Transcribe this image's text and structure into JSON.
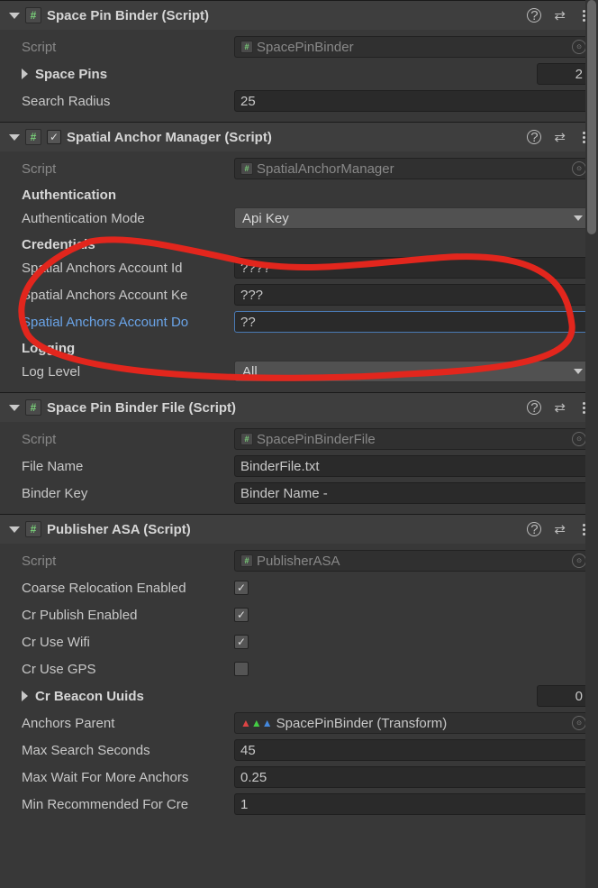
{
  "components": [
    {
      "key": "spb",
      "title": "Space Pin Binder (Script)",
      "checkbox": false,
      "script": "SpacePinBinder",
      "spacePinsCount": "2",
      "searchRadius": "25",
      "labels": {
        "script": "Script",
        "spacePins": "Space Pins",
        "searchRadius": "Search Radius"
      }
    },
    {
      "key": "sam",
      "title": "Spatial Anchor Manager (Script)",
      "checkbox": true,
      "checked": true,
      "script": "SpatialAnchorManager",
      "auth": {
        "header": "Authentication",
        "modeLabel": "Authentication Mode",
        "mode": "Api Key"
      },
      "creds": {
        "header": "Credentials",
        "idLabel": "Spatial Anchors Account Id",
        "id": "????",
        "keyLabel": "Spatial Anchors Account Ke",
        "keyv": "???",
        "domLabel": "Spatial Anchors Account Do",
        "dom": "??"
      },
      "log": {
        "header": "Logging",
        "levelLabel": "Log Level",
        "level": "All"
      },
      "labels": {
        "script": "Script"
      }
    },
    {
      "key": "spbf",
      "title": "Space Pin Binder File (Script)",
      "checkbox": false,
      "script": "SpacePinBinderFile",
      "fileName": "BinderFile.txt",
      "binderKey": "Binder Name -",
      "labels": {
        "script": "Script",
        "fileName": "File Name",
        "binderKey": "Binder Key"
      }
    },
    {
      "key": "pasa",
      "title": "Publisher ASA (Script)",
      "checkbox": false,
      "script": "PublisherASA",
      "coarse": true,
      "crPublish": true,
      "crWifi": true,
      "crGps": false,
      "beaconCount": "0",
      "anchorsParent": "SpacePinBinder (Transform)",
      "maxSearch": "45",
      "maxWait": "0.25",
      "minRec": "1",
      "labels": {
        "script": "Script",
        "coarse": "Coarse Relocation Enabled",
        "crPublish": "Cr Publish Enabled",
        "crWifi": "Cr Use Wifi",
        "crGps": "Cr Use GPS",
        "beacon": "Cr Beacon Uuids",
        "anchorsParent": "Anchors Parent",
        "maxSearch": "Max Search Seconds",
        "maxWait": "Max Wait For More Anchors",
        "minRec": "Min Recommended For Cre"
      }
    }
  ],
  "icons": {
    "hash": "#",
    "check": "✓"
  }
}
